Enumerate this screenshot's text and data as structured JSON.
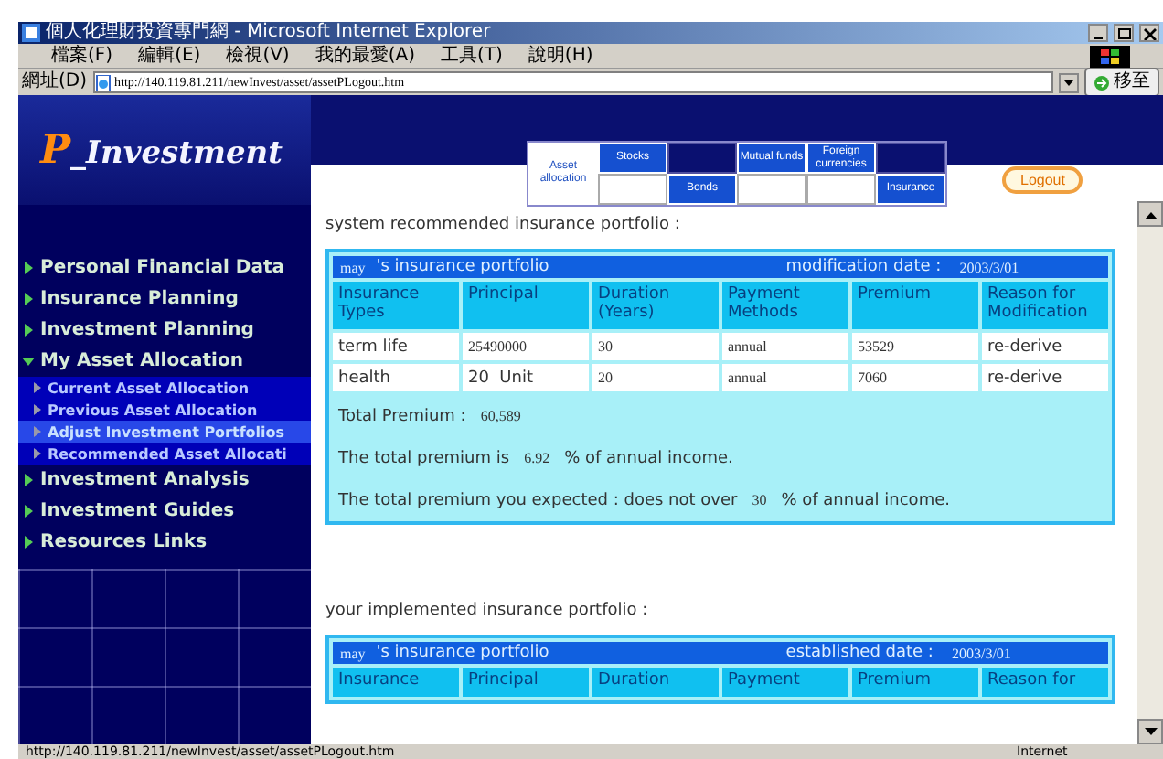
{
  "window": {
    "title": "個人化理財投資專門網 - Microsoft Internet Explorer"
  },
  "menu": [
    "檔案(F)",
    "編輯(E)",
    "檢視(V)",
    "我的最愛(A)",
    "工具(T)",
    "說明(H)"
  ],
  "address": {
    "label": "網址(D)",
    "url": "http://140.119.81.211/newInvest/asset/assetPLogout.htm",
    "go": "移至"
  },
  "sidebar": {
    "logo_initial": "P",
    "logo_rest": "_Investment",
    "items": [
      {
        "label": "Personal Financial Data",
        "expanded": false
      },
      {
        "label": "Insurance Planning",
        "expanded": false
      },
      {
        "label": "Investment Planning",
        "expanded": false
      },
      {
        "label": "My Asset Allocation",
        "expanded": true,
        "children": [
          {
            "label": "Current Asset Allocation",
            "selected": false
          },
          {
            "label": "Previous Asset Allocation",
            "selected": false
          },
          {
            "label": "Adjust Investment Portfolios",
            "selected": true
          },
          {
            "label": "Recommended Asset Allocati",
            "selected": false
          }
        ]
      },
      {
        "label": "Investment Analysis",
        "expanded": false
      },
      {
        "label": "Investment Guides",
        "expanded": false
      },
      {
        "label": "Resources Links",
        "expanded": false
      }
    ]
  },
  "tabs": [
    {
      "label": "Asset allocation",
      "kind": "full",
      "selected": true
    },
    {
      "label": "Stocks",
      "kind": "upper",
      "selected": false
    },
    {
      "label": "Bonds",
      "kind": "lower",
      "selected": false
    },
    {
      "label": "Mutual funds",
      "kind": "upper",
      "selected": false
    },
    {
      "label": "Foreign currencies",
      "kind": "upper",
      "selected": false
    },
    {
      "label": "Insurance",
      "kind": "lower",
      "selected": false
    }
  ],
  "logout": "Logout",
  "sections": [
    {
      "heading": "system recommended insurance portfolio :",
      "table": {
        "owner": "may",
        "title": "'s insurance portfolio",
        "date_label": "modification date :",
        "date": "2003/3/01",
        "columns": [
          "Insurance Types",
          "Principal",
          "Duration (Years)",
          "Payment Methods",
          "Premium",
          "Reason for Modification"
        ],
        "rows": [
          [
            "term life",
            "25490000",
            "30",
            "annual",
            "53529",
            "re-derive"
          ],
          [
            "health",
            "20  Unit",
            "20",
            "annual",
            "7060",
            "re-derive"
          ]
        ]
      },
      "summary": [
        [
          {
            "kind": "text",
            "text": "Total Premium :"
          },
          {
            "kind": "value",
            "text": "60,589"
          }
        ],
        [
          {
            "kind": "text",
            "text": "The total premium is"
          },
          {
            "kind": "value",
            "text": "6.92"
          },
          {
            "kind": "text",
            "text": "% of annual income."
          }
        ],
        [
          {
            "kind": "text",
            "text": "The total premium you expected : does not over"
          },
          {
            "kind": "value",
            "text": "30"
          },
          {
            "kind": "text",
            "text": "% of annual income."
          }
        ]
      ]
    },
    {
      "heading": "your implemented insurance portfolio :",
      "table": {
        "owner": "may",
        "title": "'s insurance portfolio",
        "date_label": "established date :",
        "date": "2003/3/01",
        "columns": [
          "Insurance",
          "Principal",
          "Duration",
          "Payment",
          "Premium",
          "Reason for"
        ]
      }
    }
  ],
  "status_bar": {
    "text": "http://140.119.81.211/newInvest/asset/assetPLogout.htm",
    "zone": "Internet"
  }
}
